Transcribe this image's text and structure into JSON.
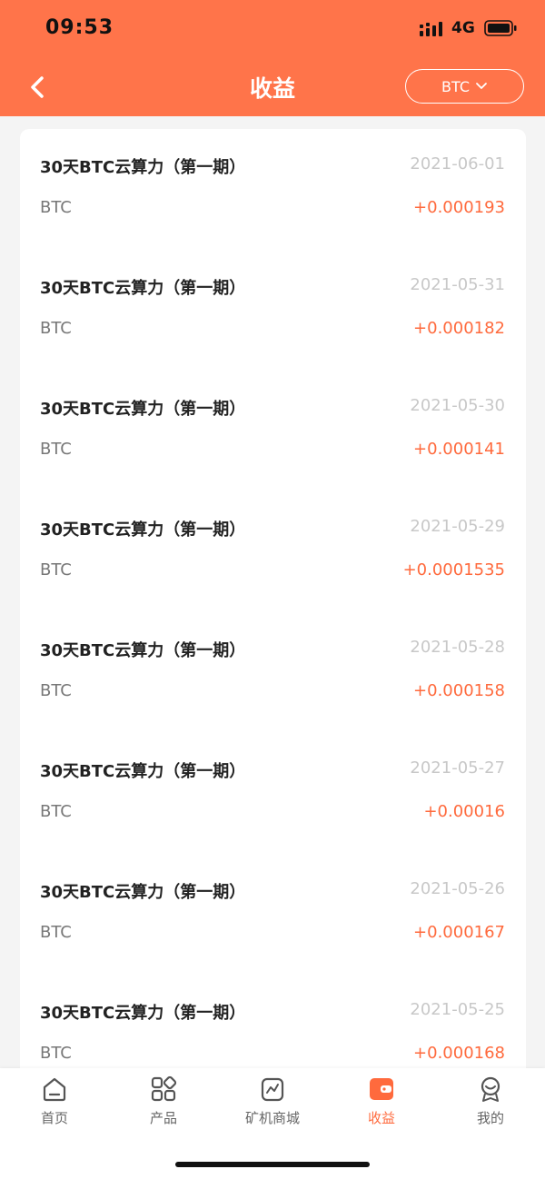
{
  "status_bar": {
    "time": "09:53",
    "network": "4G"
  },
  "nav": {
    "title": "收益",
    "currency_selected": "BTC",
    "colors": {
      "header_bg": "#ff744a",
      "amount": "#ff6a3d"
    }
  },
  "entries": [
    {
      "title": "30天BTC云算力（第一期）",
      "date": "2021-06-01",
      "currency": "BTC",
      "amount": "+0.000193"
    },
    {
      "title": "30天BTC云算力（第一期）",
      "date": "2021-05-31",
      "currency": "BTC",
      "amount": "+0.000182"
    },
    {
      "title": "30天BTC云算力（第一期）",
      "date": "2021-05-30",
      "currency": "BTC",
      "amount": "+0.000141"
    },
    {
      "title": "30天BTC云算力（第一期）",
      "date": "2021-05-29",
      "currency": "BTC",
      "amount": "+0.0001535"
    },
    {
      "title": "30天BTC云算力（第一期）",
      "date": "2021-05-28",
      "currency": "BTC",
      "amount": "+0.000158"
    },
    {
      "title": "30天BTC云算力（第一期）",
      "date": "2021-05-27",
      "currency": "BTC",
      "amount": "+0.00016"
    },
    {
      "title": "30天BTC云算力（第一期）",
      "date": "2021-05-26",
      "currency": "BTC",
      "amount": "+0.000167"
    },
    {
      "title": "30天BTC云算力（第一期）",
      "date": "2021-05-25",
      "currency": "BTC",
      "amount": "+0.000168"
    }
  ],
  "tabs": [
    {
      "label": "首页",
      "icon": "home-icon",
      "active": false
    },
    {
      "label": "产品",
      "icon": "grid-icon",
      "active": false
    },
    {
      "label": "矿机商城",
      "icon": "chart-bag-icon",
      "active": false
    },
    {
      "label": "收益",
      "icon": "wallet-icon",
      "active": true
    },
    {
      "label": "我的",
      "icon": "profile-icon",
      "active": false
    }
  ]
}
